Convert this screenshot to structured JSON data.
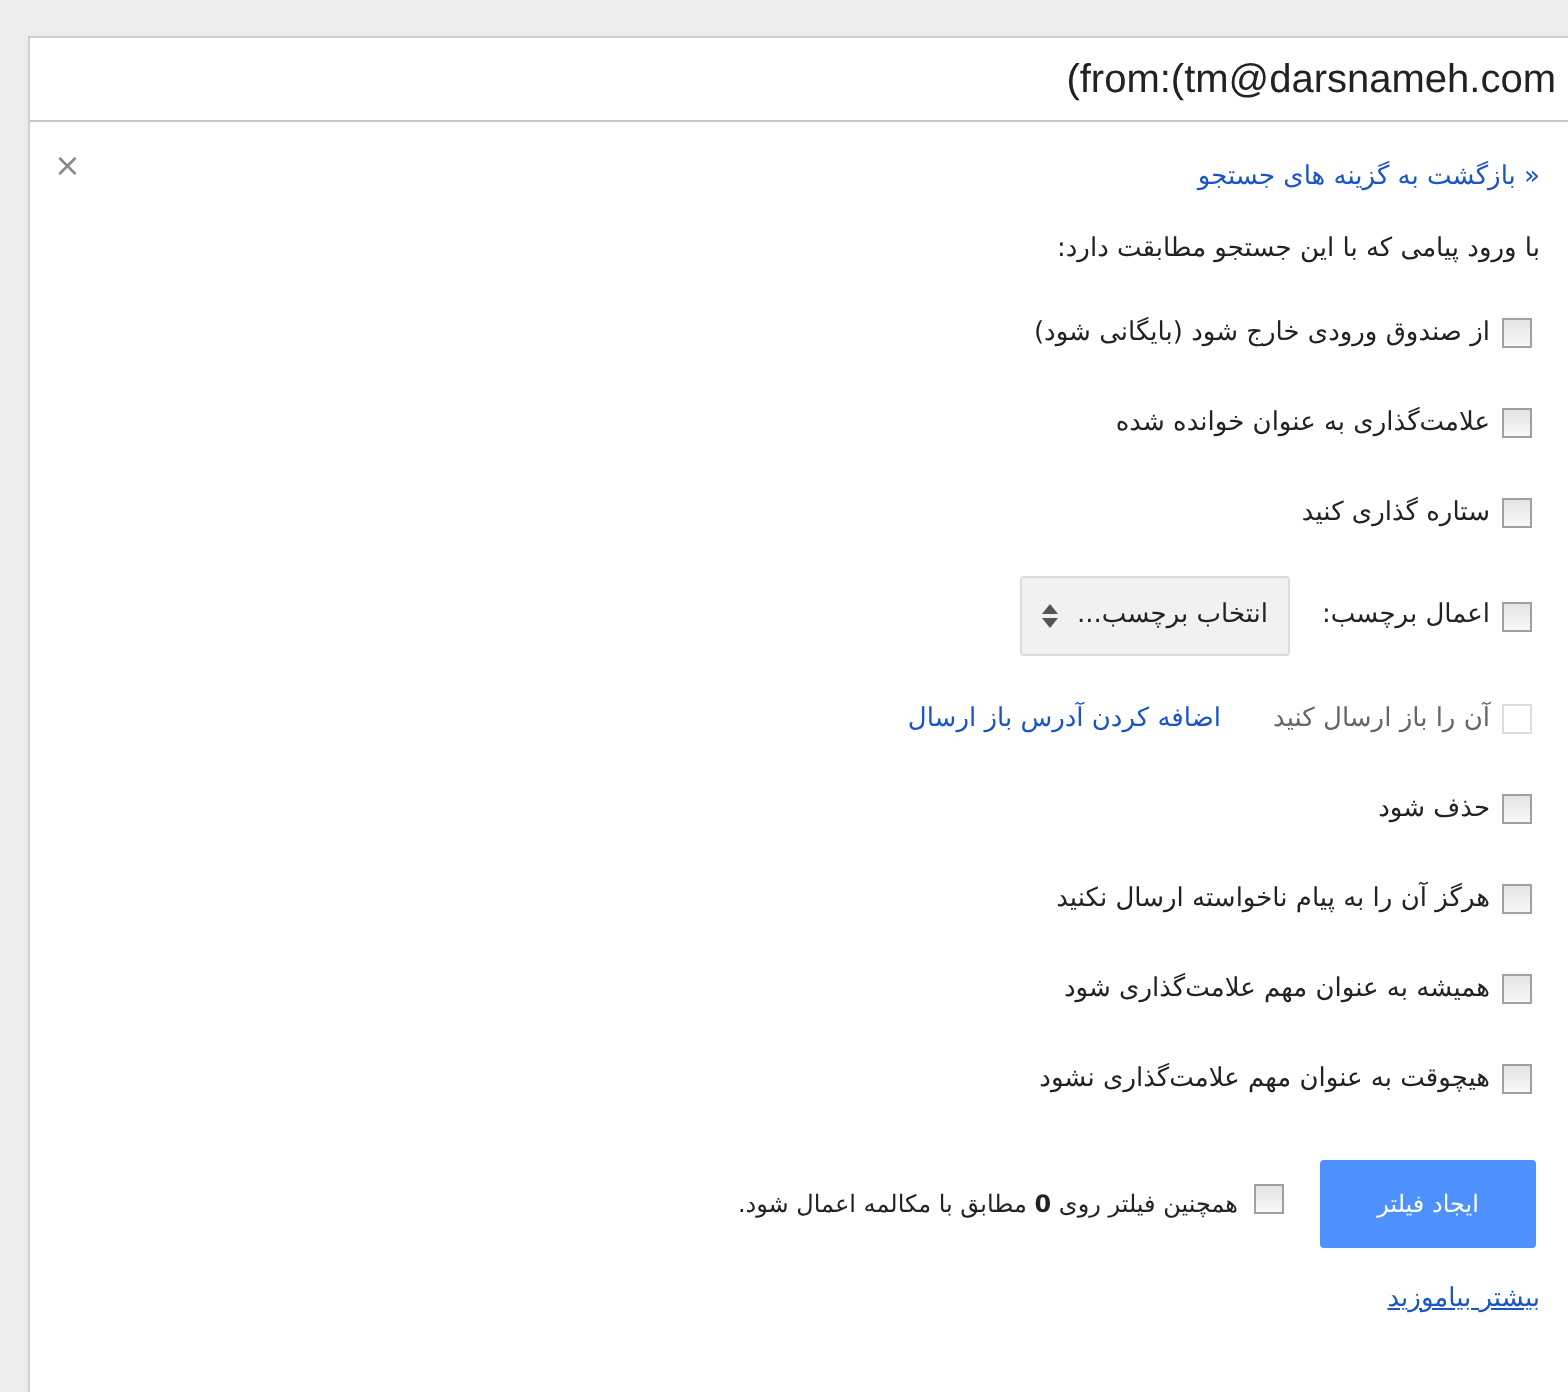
{
  "search": {
    "value": "(from:(tm@darsnameh.com"
  },
  "close": "×",
  "back_link": "« بازگشت به گزینه های جستجو",
  "intro": "با ورود پیامی که با این جستجو مطابقت دارد:",
  "actions": [
    {
      "kind": "plain",
      "label": "از صندوق ورودی خارج شود (بایگانی شود)",
      "checked": false,
      "disabled": false
    },
    {
      "kind": "plain",
      "label": "علامت‌گذاری به عنوان خوانده شده",
      "checked": false,
      "disabled": false
    },
    {
      "kind": "plain",
      "label": "ستاره گذاری کنید",
      "checked": false,
      "disabled": false
    },
    {
      "kind": "label",
      "label": "اعمال برچسب:",
      "select": "انتخاب برچسب...",
      "checked": false,
      "disabled": false
    },
    {
      "kind": "forward",
      "label": "آن را باز ارسال کنید",
      "link": "اضافه کردن آدرس باز ارسال",
      "checked": false,
      "disabled": true
    },
    {
      "kind": "plain",
      "label": "حذف شود",
      "checked": false,
      "disabled": false
    },
    {
      "kind": "plain",
      "label": "هرگز آن را به پیام ناخواسته ارسال نکنید",
      "checked": false,
      "disabled": false
    },
    {
      "kind": "plain",
      "label": "همیشه به عنوان مهم علامت‌گذاری شود",
      "checked": false,
      "disabled": false
    },
    {
      "kind": "plain",
      "label": "هیچوقت به عنوان مهم علامت‌گذاری نشود",
      "checked": false,
      "disabled": false
    }
  ],
  "create_button": "ایجاد فیلتر",
  "apply_also": {
    "text": "همچنین فیلتر روی **0** مطابق با مکالمه اعمال شود.",
    "checked": false
  },
  "learn_more": "بیشتر بیاموزید"
}
